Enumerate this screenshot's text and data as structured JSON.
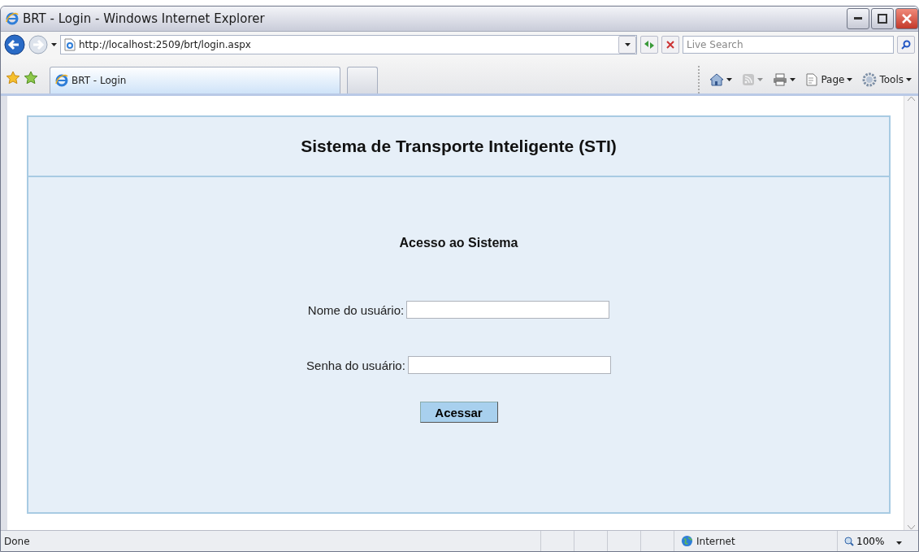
{
  "window": {
    "title": "BRT - Login - Windows Internet Explorer"
  },
  "address_bar": {
    "url": "http://localhost:2509/brt/login.aspx"
  },
  "search": {
    "placeholder": "Live Search"
  },
  "tabs": [
    {
      "label": "BRT - Login",
      "selected": true
    },
    {
      "selected": false
    }
  ],
  "command_bar": [
    {
      "kind": "home"
    },
    {
      "kind": "feeds",
      "disabled": true
    },
    {
      "kind": "print"
    },
    {
      "kind": "page",
      "label": "Page"
    },
    {
      "kind": "tools",
      "label": "Tools"
    }
  ],
  "page": {
    "header": "Sistema de Transporte Inteligente (STI)",
    "form_title": "Acesso ao Sistema",
    "fields": [
      {
        "label": "Nome do usuário:"
      },
      {
        "label": "Senha do usuário:"
      }
    ],
    "button": "Acessar"
  },
  "status_bar": {
    "text": "Done",
    "zone": "Internet",
    "zoom": "100%"
  }
}
